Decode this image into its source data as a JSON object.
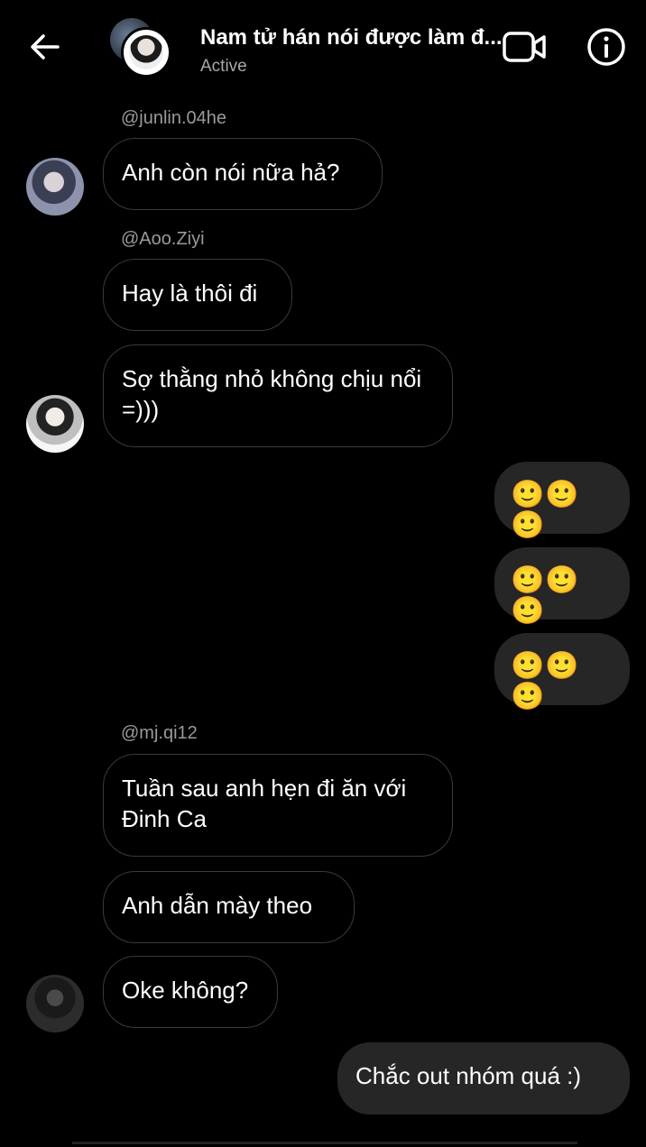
{
  "header": {
    "back_icon": "back-arrow-icon",
    "title": "Nam tử hán nói được làm đ...",
    "status": "Active",
    "video_icon": "video-call-icon",
    "info_icon": "info-icon"
  },
  "messages": [
    {
      "handle": "@junlin.04he",
      "text": "Anh còn nói nữa hả?"
    },
    {
      "handle": "@Aoo.Ziyi",
      "text": "Hay là thôi đi"
    },
    {
      "text": "Sợ thằng nhỏ không chịu nổi =)))"
    },
    {
      "outgoing": true,
      "text": "🙂🙂🙂"
    },
    {
      "outgoing": true,
      "text": "🙂🙂🙂"
    },
    {
      "outgoing": true,
      "text": "🙂🙂🙂"
    },
    {
      "handle": "@mj.qi12",
      "text": "Tuần sau anh hẹn đi ăn với Đinh Ca"
    },
    {
      "text": "Anh dẫn mày theo"
    },
    {
      "text": "Oke không?"
    },
    {
      "outgoing": true,
      "text": "Chắc out nhóm quá :)"
    }
  ]
}
